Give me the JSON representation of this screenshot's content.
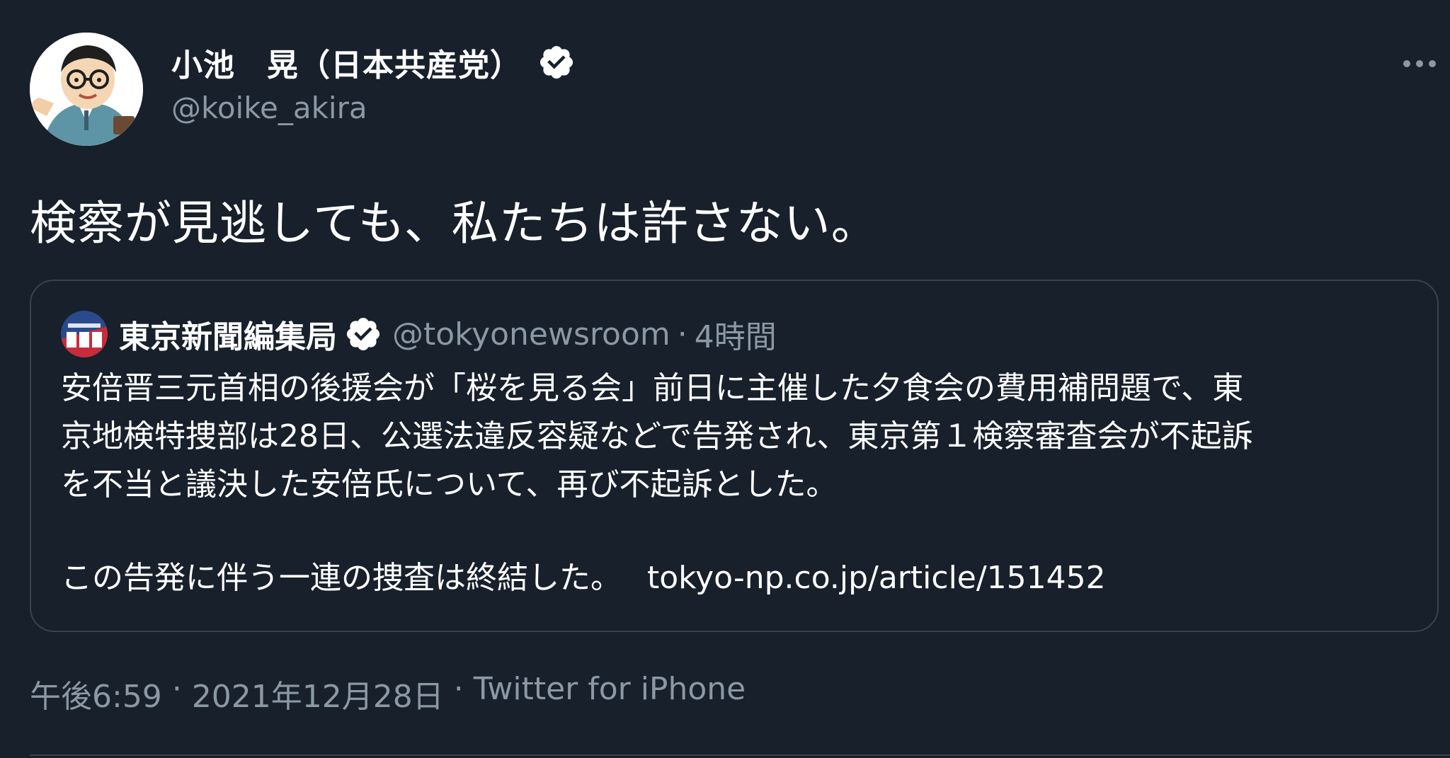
{
  "author": {
    "display_name": "小池　晃（日本共産党）",
    "handle": "@koike_akira",
    "verified": true,
    "avatar_icon": "cartoon-avatar-icon"
  },
  "tweet": {
    "text": "検察が見逃しても、私たちは許さない。"
  },
  "quoted_tweet": {
    "display_name": "東京新聞編集局",
    "handle": "@tokyonewsroom",
    "separator": "·",
    "time_ago": "4時間",
    "verified": true,
    "avatar_icon": "newsroom-logo-icon",
    "body_lines": [
      "安倍晋三元首相の後援会が「桜を見る会」前日に主催した夕食会の費用補問題で、東",
      "京地検特捜部は28日、公選法違反容疑などで告発され、東京第１検察審査会が不起訴",
      "を不当と議決した安倍氏について、再び不起訴とした。"
    ],
    "last_line": "この告発に伴う一連の捜査は終結した。",
    "link": "tokyo-np.co.jp/article/151452"
  },
  "meta": {
    "time": "午後6:59",
    "separator": "·",
    "date": "2021年12月28日",
    "source": "Twitter for iPhone"
  },
  "colors": {
    "background": "#17202b",
    "primary_text": "#ffffff",
    "secondary_text": "#8b98a5",
    "border": "#38444d"
  }
}
